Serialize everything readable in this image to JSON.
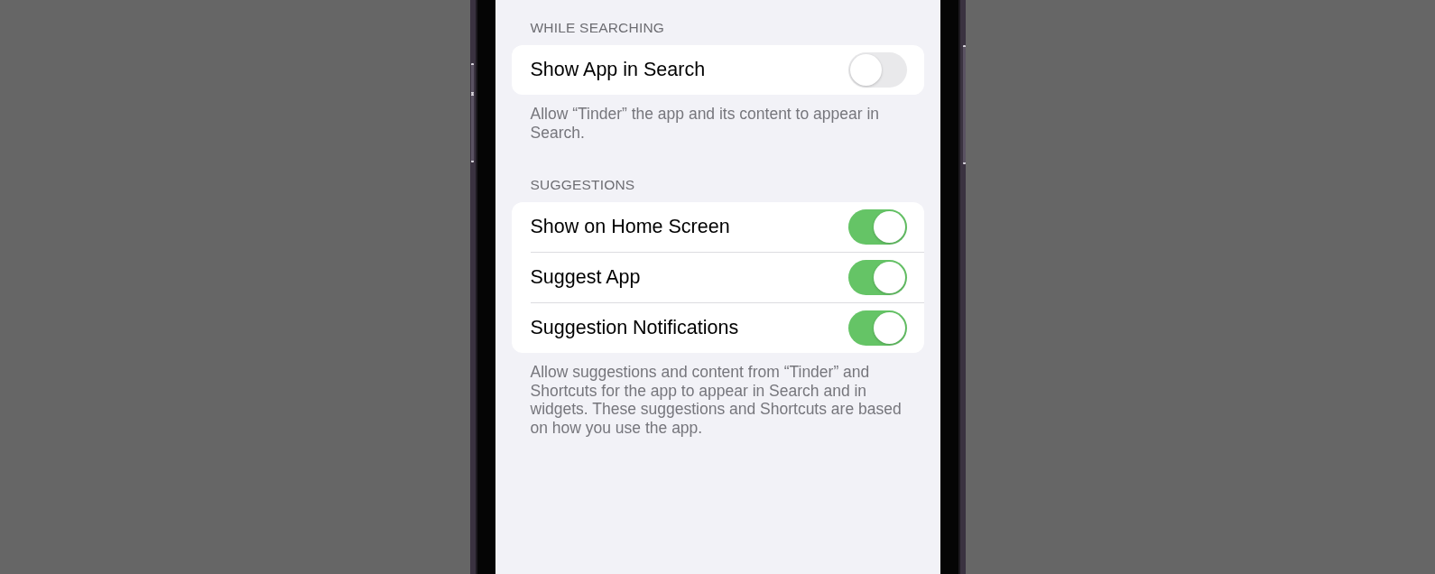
{
  "sections": [
    {
      "header": "WHILE SEARCHING",
      "rows": [
        {
          "label": "Show App in Search",
          "on": false
        }
      ],
      "footer": "Allow “Tinder” the app and its content to appear in Search."
    },
    {
      "header": "SUGGESTIONS",
      "rows": [
        {
          "label": "Show on Home Screen",
          "on": true
        },
        {
          "label": "Suggest App",
          "on": true
        },
        {
          "label": "Suggestion Notifications",
          "on": true
        }
      ],
      "footer": "Allow suggestions and content from “Tinder” and Shortcuts for the app to appear in Search and in widgets. These suggestions and Shortcuts are based on how you use the app."
    }
  ]
}
